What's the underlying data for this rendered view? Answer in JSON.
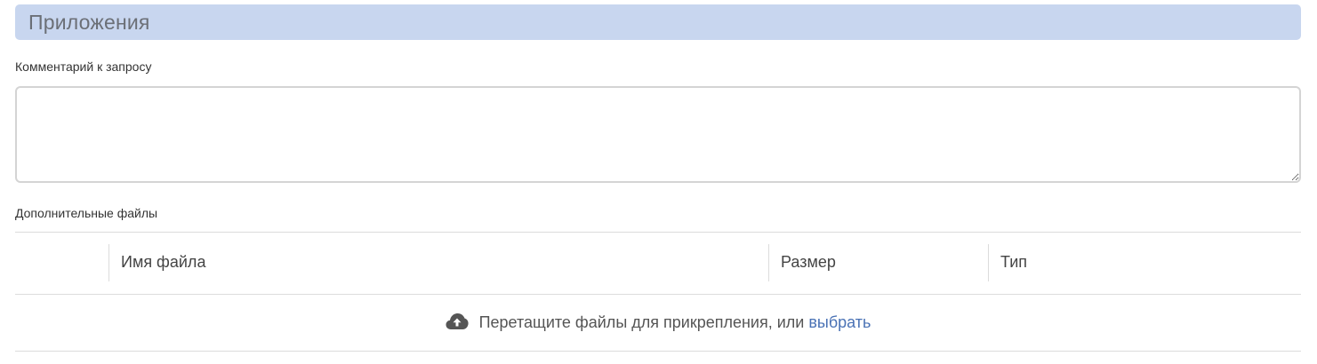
{
  "section": {
    "title": "Приложения"
  },
  "comment": {
    "label": "Комментарий к запросу",
    "value": ""
  },
  "files": {
    "label": "Дополнительные файлы",
    "columns": [
      "",
      "Имя файла",
      "Размер",
      "Тип"
    ],
    "dropzone_text": "Перетащите файлы для прикрепления, или",
    "choose_link": "выбрать",
    "upload_icon": "cloud-upload-icon"
  },
  "colors": {
    "header_bg": "#c8d6ef",
    "link": "#4a72b5"
  }
}
